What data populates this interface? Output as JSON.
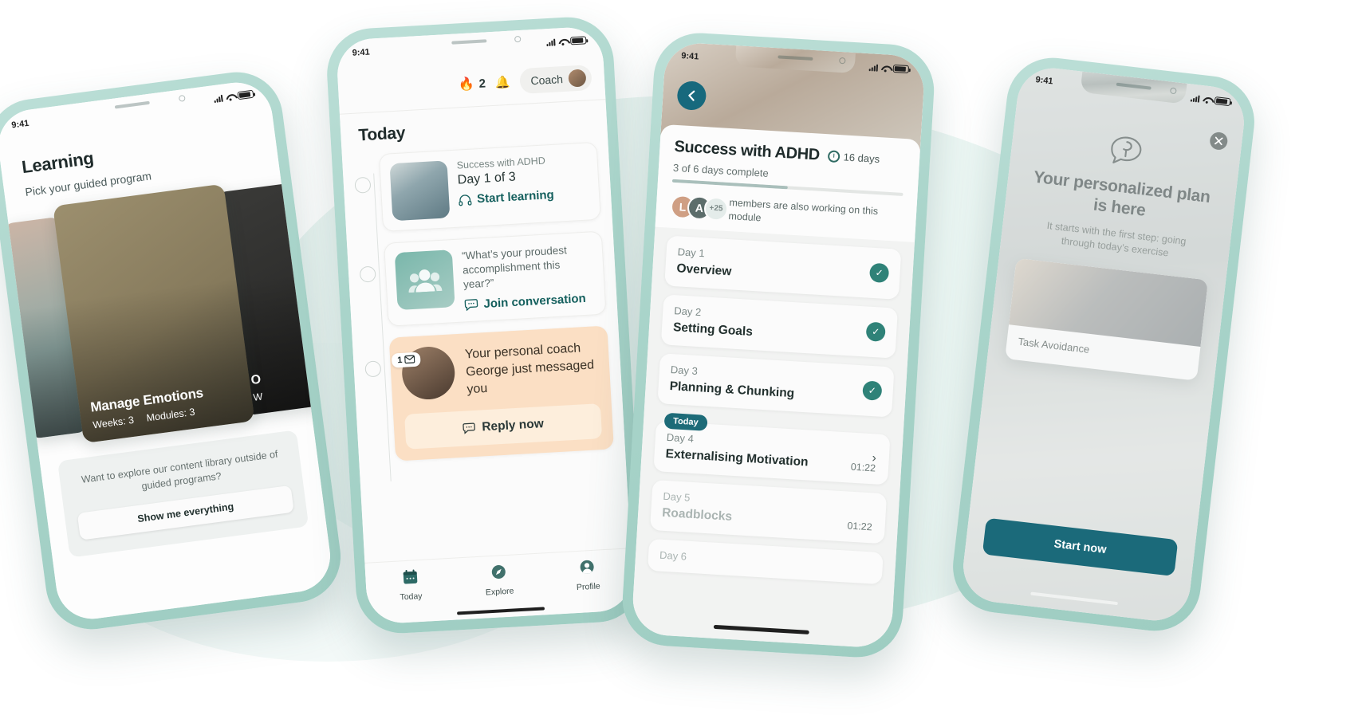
{
  "colors": {
    "frame": "#a9d4ca",
    "background": "#ffffff",
    "blob": "#e8f4f1",
    "accent_teal": "#15605e",
    "deep_teal": "#1b6a7a",
    "check_green": "#2f8278",
    "coach_peach": "#fbdfc4",
    "reply_peach": "#fdeedc"
  },
  "phone1": {
    "status": {
      "time": "9:41"
    },
    "title": "Learning",
    "subtitle": "Pick your guided program",
    "cards": [
      {
        "title": "Manage Emotions",
        "weeks_label": "Weeks: 3",
        "modules_label": "Modules: 3"
      },
      {
        "title": "O",
        "weeks_label": "W"
      }
    ],
    "promo": {
      "text": "Want to explore our content library outside of guided programs?",
      "button": "Show me everything"
    }
  },
  "phone2": {
    "status": {
      "time": "9:41"
    },
    "header": {
      "streak_count": "2",
      "flame_icon": "flame-icon",
      "bell_icon": "bell-icon",
      "coach_label": "Coach"
    },
    "section_title": "Today",
    "timeline": [
      {
        "eyebrow": "Success with ADHD",
        "main": "Day 1 of 3",
        "action": "Start learning",
        "action_icon": "headphones-icon",
        "thumb": "group-photo"
      },
      {
        "quote": "“What’s your proudest accomplishment this year?”",
        "action": "Join conversation",
        "action_icon": "chat-bubble-icon",
        "thumb": "people-icon"
      }
    ],
    "coach_card": {
      "badge_count": "1",
      "badge_icon": "envelope-icon",
      "message": "Your personal coach George just messaged you",
      "button": "Reply now",
      "button_icon": "chat-bubble-icon"
    },
    "tabs": [
      {
        "label": "Today",
        "icon": "calendar-icon",
        "active": true
      },
      {
        "label": "Explore",
        "icon": "compass-icon",
        "active": false
      },
      {
        "label": "Profile",
        "icon": "person-icon",
        "active": false
      }
    ]
  },
  "phone3": {
    "status": {
      "time": "9:41"
    },
    "back_icon": "chevron-left-icon",
    "title": "Success with ADHD",
    "duration": "16 days",
    "duration_icon": "clock-icon",
    "progress_label": "3 of 6 days complete",
    "progress_percent": 50,
    "members": {
      "avatars": [
        "L",
        "A"
      ],
      "overflow": "+25",
      "text": "members are also working on this module"
    },
    "days": [
      {
        "day": "Day 1",
        "title": "Overview",
        "state": "done"
      },
      {
        "day": "Day 2",
        "title": "Setting Goals",
        "state": "done"
      },
      {
        "day": "Day 3",
        "title": "Planning & Chunking",
        "state": "done"
      },
      {
        "day": "Day 4",
        "title": "Externalising Motivation",
        "state": "today",
        "chip": "Today",
        "time": "01:22"
      },
      {
        "day": "Day 5",
        "title": "Roadblocks",
        "state": "future",
        "time": "01:22"
      },
      {
        "day": "Day 6",
        "title": "",
        "state": "future"
      }
    ]
  },
  "phone4": {
    "status": {
      "time": "9:41"
    },
    "close_icon": "close-icon",
    "logo_icon": "brain-speech-bubble-icon",
    "title": "Your personalized plan is here",
    "subtitle": "It starts with the first step: going through today’s exercise",
    "exercise_card": {
      "caption": "Task Avoidance"
    },
    "cta": "Start now"
  }
}
